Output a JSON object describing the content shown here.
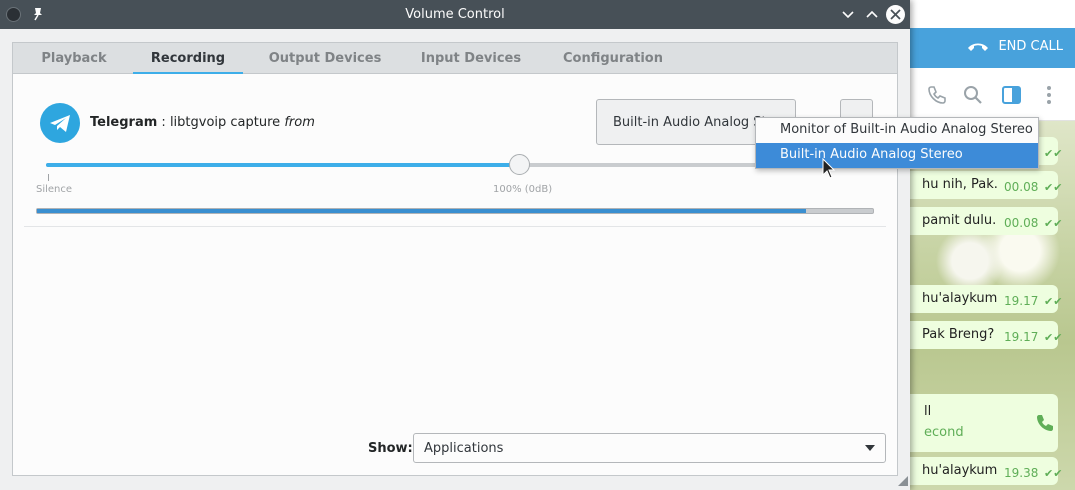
{
  "window": {
    "title": "Volume Control"
  },
  "tabs": [
    {
      "label": "Playback"
    },
    {
      "label": "Recording"
    },
    {
      "label": "Output Devices"
    },
    {
      "label": "Input Devices"
    },
    {
      "label": "Configuration"
    }
  ],
  "active_tab": "Recording",
  "stream": {
    "app_name": "Telegram",
    "separator": " : ",
    "description": "libtgvoip capture",
    "from_word": "from",
    "device_button_label": "Built-in Audio Analog Stereo",
    "volume_percent": 100,
    "volume_fraction_of_slider": 0.57,
    "level_meter_fraction": 0.92,
    "scale_labels": {
      "silence": "Silence",
      "hundred": "100% (0dB)"
    }
  },
  "device_dropdown": {
    "options": [
      {
        "label": "Monitor of Built-in Audio Analog Stereo"
      },
      {
        "label": "Built-in Audio Analog Stereo"
      }
    ],
    "highlighted_index": 1
  },
  "footer": {
    "show_label": "Show:",
    "show_value": "Applications"
  },
  "background_app": {
    "end_call_label": "END CALL",
    "messages": [
      {
        "text": "",
        "time": ""
      },
      {
        "text": "hu nih, Pak.",
        "time": "00.08"
      },
      {
        "text": "pamit dulu.",
        "time": "00.08"
      },
      {
        "text": "hu'alaykum",
        "time": "19.17"
      },
      {
        "text": "Pak Breng?",
        "time": "19.17"
      },
      {
        "text": "hu'alaykum",
        "time": "19.38"
      }
    ],
    "call_title": "ll",
    "call_subtitle": "econd"
  },
  "colors": {
    "accent": "#3daee9",
    "selection": "#3d8bd8",
    "titlebar": "#475057",
    "telegram_blue": "#2ea6df",
    "telegram_header": "#48a2dc",
    "check_green": "#5fae57"
  }
}
